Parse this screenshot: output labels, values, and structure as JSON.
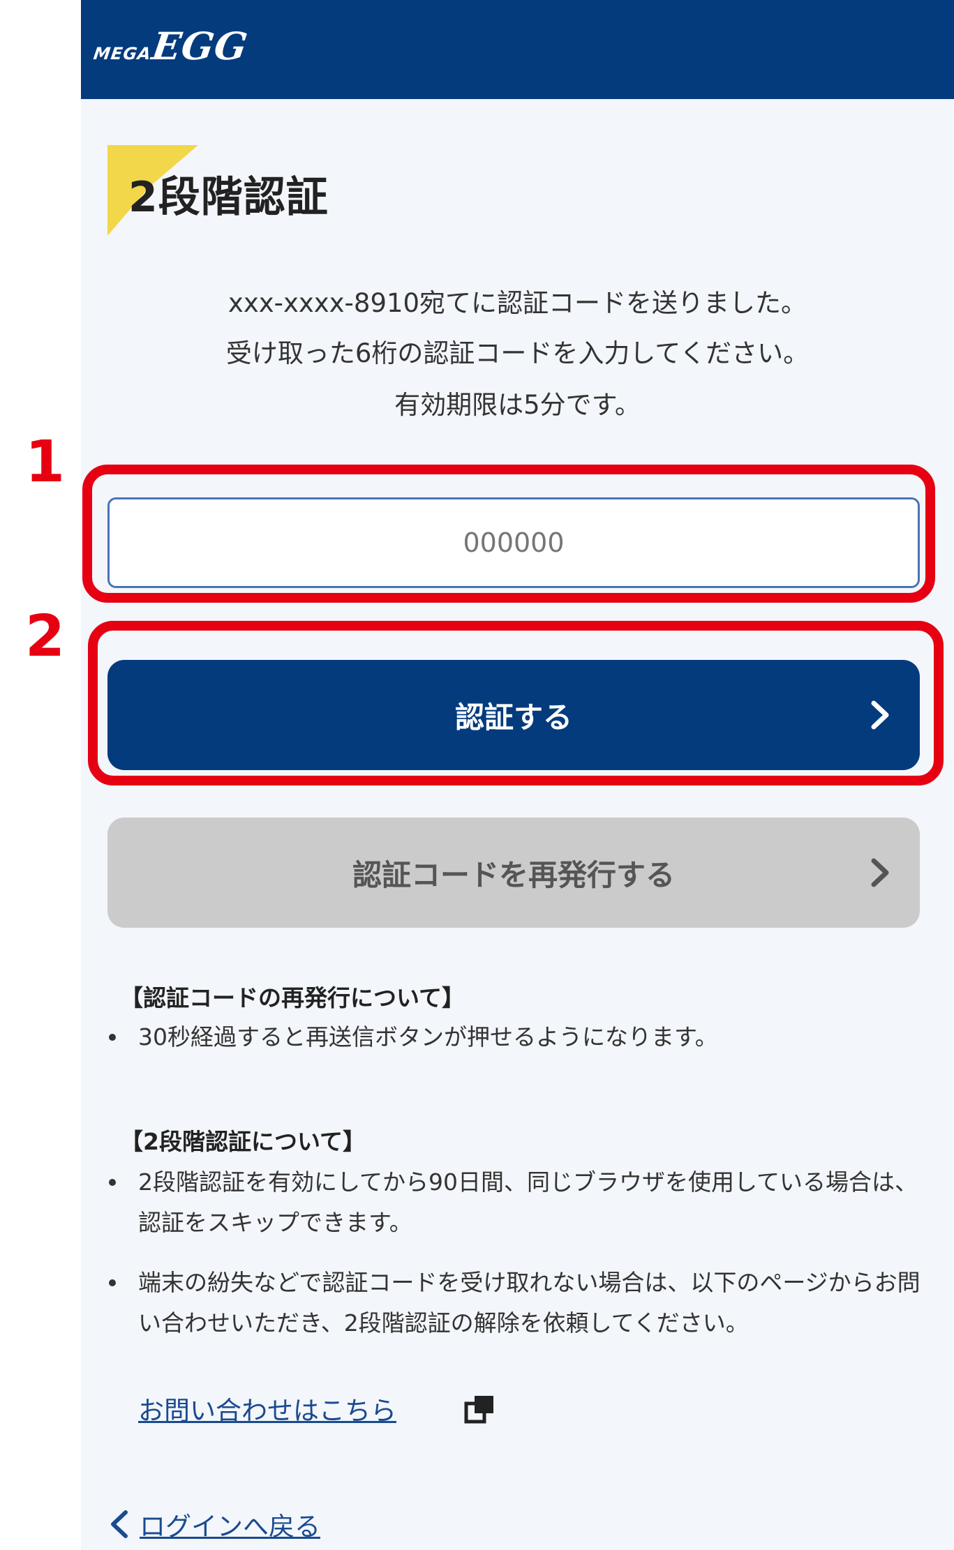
{
  "header": {
    "logo_mega": "MEGA",
    "logo_egg": "EGG"
  },
  "page": {
    "title": "2段階認証",
    "description": [
      "xxx-xxxx-8910宛てに認証コードを送りました。",
      "受け取った6桁の認証コードを入力してください。",
      "有効期限は5分です。"
    ]
  },
  "annotations": [
    {
      "number": "1",
      "color": "#e60012"
    },
    {
      "number": "2",
      "color": "#e60012"
    }
  ],
  "form": {
    "code_input": {
      "value": "",
      "placeholder": "000000"
    },
    "verify_button": "認証する",
    "resend_button": "認証コードを再発行する"
  },
  "info": {
    "resend": {
      "heading": "【認証コードの再発行について】",
      "items": [
        "30秒経過すると再送信ボタンが押せるようになります。"
      ]
    },
    "two_factor": {
      "heading": "【2段階認証について】",
      "items": [
        "2段階認証を有効にしてから90日間、同じブラウザを使用している場合は、認証をスキップできます。",
        "端末の紛失などで認証コードを受け取れない場合は、以下のページからお問い合わせいただき、2段階認証の解除を依頼してください。"
      ],
      "contact_link": "お問い合わせはこちら"
    }
  },
  "back_link": "ログインへ戻る",
  "icons": {
    "verify_chevron": "chevron-right-icon",
    "resend_chevron": "chevron-right-icon",
    "external": "external-link-icon",
    "back": "chevron-left-icon"
  },
  "colors": {
    "brand_navy": "#043b7d",
    "accent_yellow": "#f3d74a",
    "annotation_red": "#e60012",
    "disabled_gray": "#cbcbcb",
    "link_blue": "#1a4a8f",
    "background": "#f3f6fa"
  }
}
